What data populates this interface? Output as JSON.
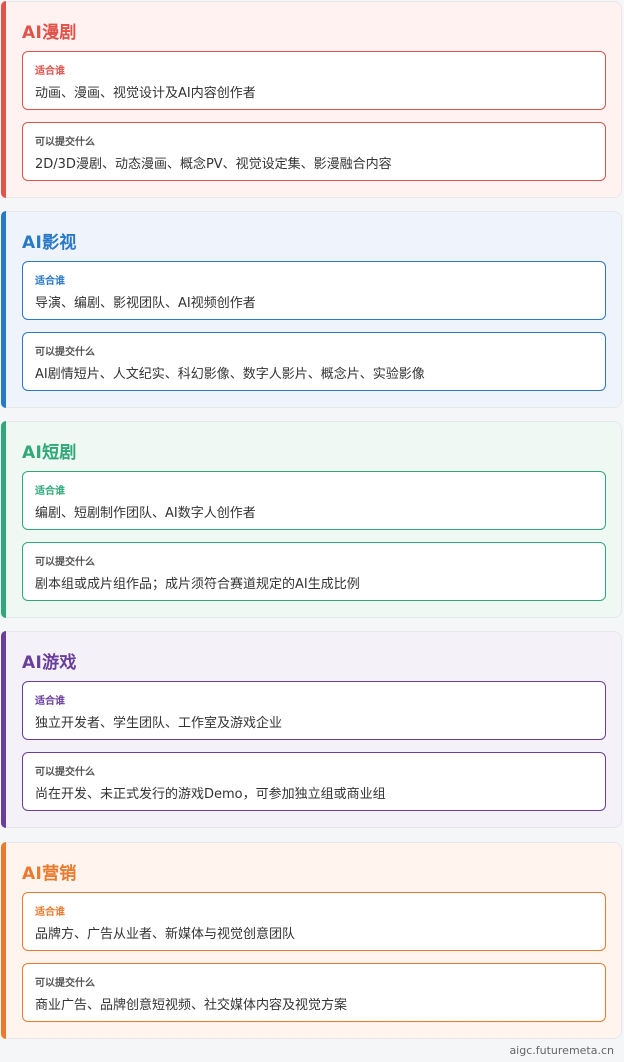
{
  "cards": [
    {
      "title": "AI漫剧",
      "accent": "#e0524a",
      "bg": "#fff2f1",
      "suitable_label": "适合谁",
      "suitable_text": "动画、漫画、视觉设计及AI内容创作者",
      "submit_label": "可以提交什么",
      "submit_text": "2D/3D漫剧、动态漫画、概念PV、视觉设定集、影漫融合内容"
    },
    {
      "title": "AI影视",
      "accent": "#2a79c6",
      "bg": "#eff4fc",
      "suitable_label": "适合谁",
      "suitable_text": "导演、编剧、影视团队、AI视频创作者",
      "submit_label": "可以提交什么",
      "submit_text": "AI剧情短片、人文纪实、科幻影像、数字人影片、概念片、实验影像"
    },
    {
      "title": "AI短剧",
      "accent": "#2fa87a",
      "bg": "#eff8f3",
      "suitable_label": "适合谁",
      "suitable_text": "编剧、短剧制作团队、AI数字人创作者",
      "submit_label": "可以提交什么",
      "submit_text": "剧本组或成片组作品；成片须符合赛道规定的AI生成比例"
    },
    {
      "title": "AI游戏",
      "accent": "#6a3f9c",
      "bg": "#f4f1f8",
      "suitable_label": "适合谁",
      "suitable_text": "独立开发者、学生团队、工作室及游戏企业",
      "submit_label": "可以提交什么",
      "submit_text": "尚在开发、未正式发行的游戏Demo，可参加独立组或商业组"
    },
    {
      "title": "AI营销",
      "accent": "#ec7a2e",
      "bg": "#fff5ee",
      "suitable_label": "适合谁",
      "suitable_text": "品牌方、广告从业者、新媒体与视觉创意团队",
      "submit_label": "可以提交什么",
      "submit_text": "商业广告、品牌创意短视频、社交媒体内容及视觉方案"
    }
  ],
  "footer": {
    "domain": "aigc.futuremeta.cn"
  }
}
